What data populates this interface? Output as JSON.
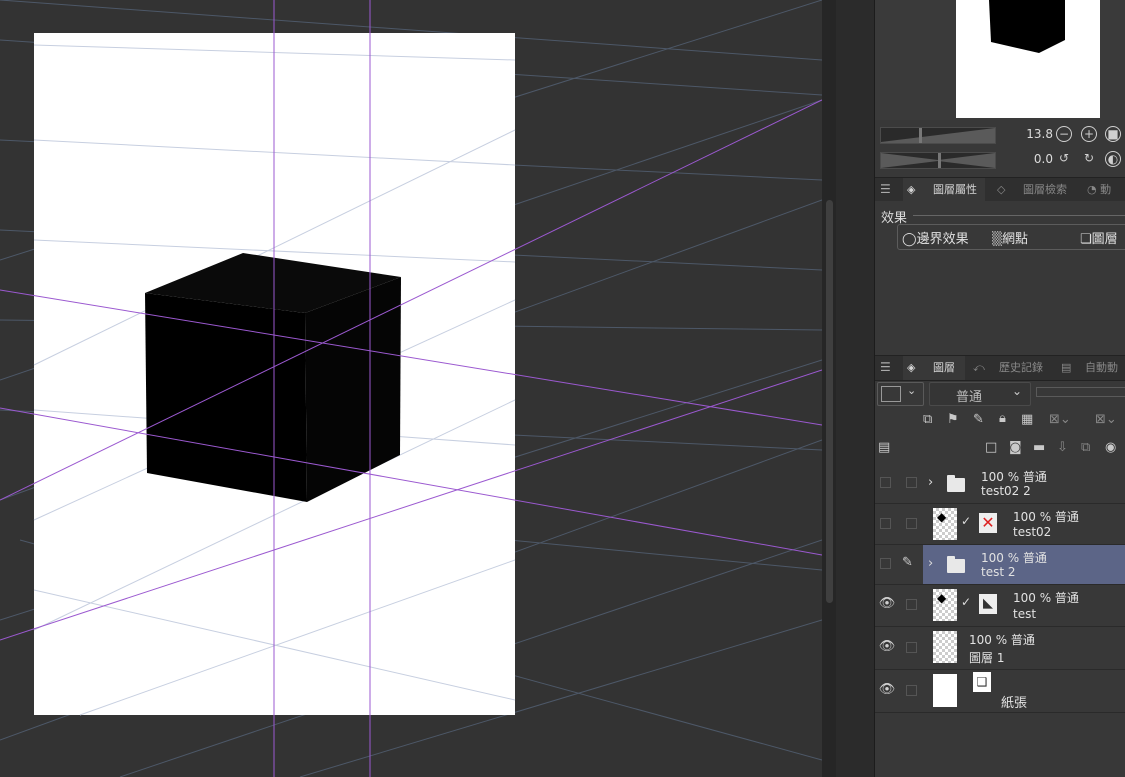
{
  "navigator": {
    "zoom_value": "13.8",
    "rotate_value": "0.0"
  },
  "tabs_top": [
    {
      "label": "圖層屬性"
    },
    {
      "label": "圖層檢索"
    }
  ],
  "effects": {
    "title": "效果",
    "items": [
      {
        "label": "邊界效果"
      },
      {
        "label": "網點"
      },
      {
        "label": "圖層"
      }
    ]
  },
  "tabs_bottom": [
    {
      "label": "圖層"
    },
    {
      "label": "歷史記錄"
    },
    {
      "label": "自動動"
    }
  ],
  "blend_mode": "普通",
  "layers": [
    {
      "mode": "100 % 普通",
      "name": "test02 2"
    },
    {
      "mode": "100 % 普通",
      "name": "test02"
    },
    {
      "mode": "100 % 普通",
      "name": "test 2"
    },
    {
      "mode": "100 % 普通",
      "name": "test"
    },
    {
      "mode": "100 % 普通",
      "name": "圖層 1"
    },
    {
      "mode": "",
      "name": "紙張"
    }
  ],
  "colors": {
    "canvas_bg": "#333333",
    "paper": "#ffffff",
    "selected_layer": "#5c6587",
    "panel_bg": "#383838",
    "perspective_line": "#9b59d0"
  }
}
